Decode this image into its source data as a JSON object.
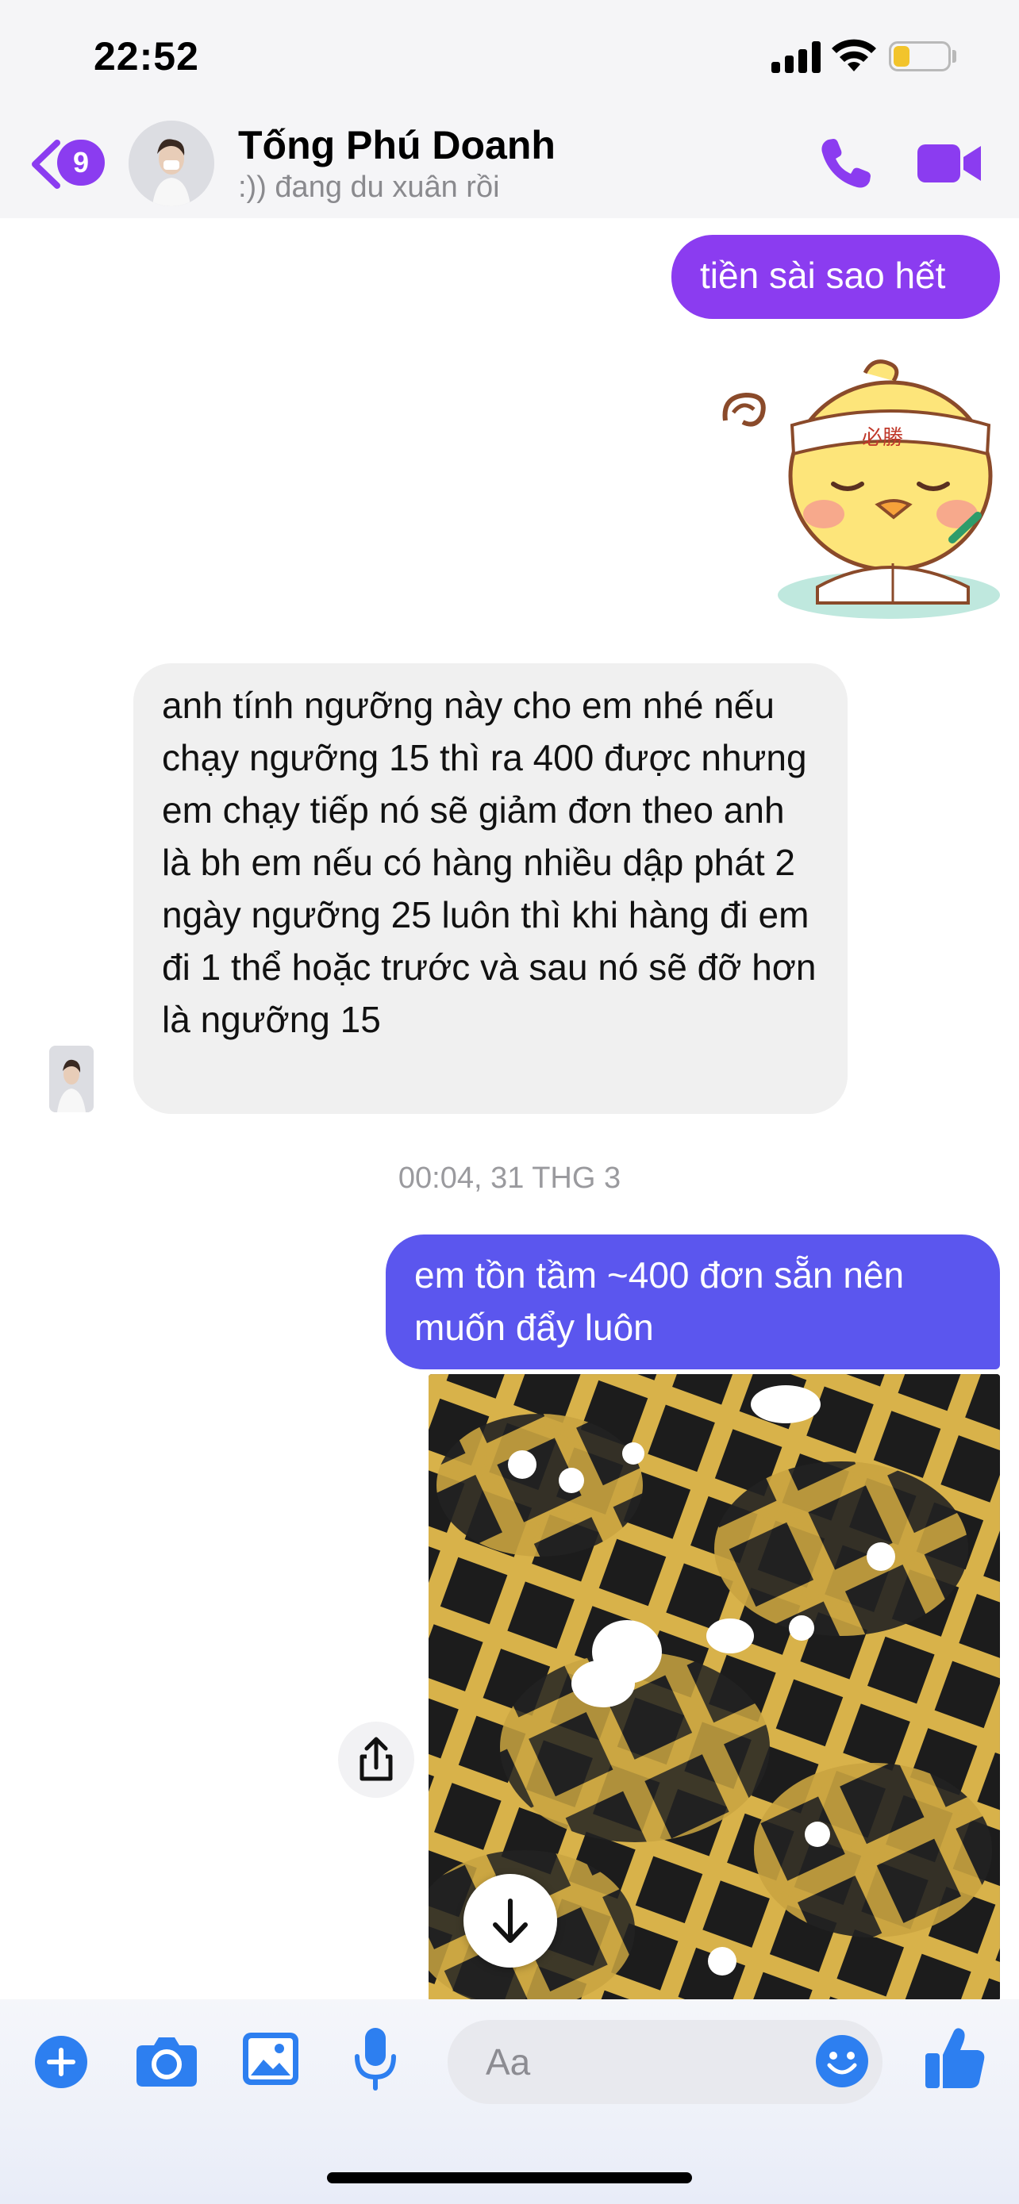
{
  "status_bar": {
    "time": "22:52"
  },
  "header": {
    "back_badge_count": "9",
    "contact_name": "Tống Phú Doanh",
    "contact_status": ":)) đang du xuân rồi"
  },
  "messages": {
    "outgoing_1": "tiền sài sao hết",
    "incoming_1": "anh tính ngưỡng này cho em nhé nếu chạy ngưỡng 15 thì ra 400 được nhưng em chạy tiếp nó sẽ giảm đơn theo anh là bh em nếu có hàng nhiều dập phát 2 ngày ngưỡng 25 luôn thì khi hàng đi em đi 1 thể hoặc trước và sau nó sẽ đỡ hơn là ngưỡng 15",
    "timestamp": "00:04, 31 THG 3",
    "outgoing_2": "em tồn tầm ~400 đơn sẵn nên muốn đẩy luôn"
  },
  "sticker": {
    "text": "必勝"
  },
  "composer": {
    "placeholder": "Aa"
  },
  "colors": {
    "accent_purple": "#8b3cf0",
    "bubble_blue": "#5b56ee",
    "composer_icon_blue": "#2d7ff0"
  },
  "icons": [
    "back-chevron-icon",
    "phone-icon",
    "video-camera-icon",
    "share-icon",
    "arrow-down-icon",
    "plus-icon",
    "camera-icon",
    "image-icon",
    "microphone-icon",
    "emoji-icon",
    "thumbs-up-icon"
  ]
}
